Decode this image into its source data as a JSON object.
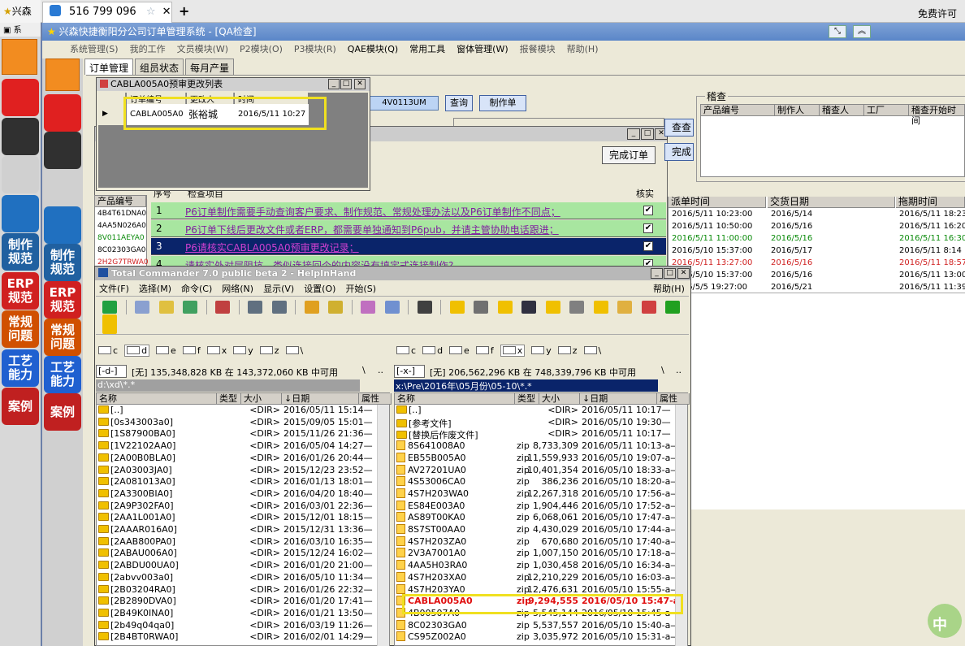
{
  "taskbar": {
    "app_name": "兴森",
    "right_text": "免费许可证"
  },
  "browser": {
    "tab_label": "516 799 096"
  },
  "main_window": {
    "title": "兴森快捷衡阳分公司订单管理系统 - [QA检查]",
    "menu": [
      "系统管理(S)",
      "我的工作",
      "文员模块(W)",
      "P2模块(O)",
      "P3模块(R)",
      "QAE模块(Q)",
      "常用工具",
      "窗体管理(W)",
      "报餐模块",
      "帮助(H)"
    ],
    "tabs": [
      "订单管理",
      "组员状态",
      "每月产量"
    ]
  },
  "left_tools": [
    {
      "label": "",
      "color": "#e02020"
    },
    {
      "label": "",
      "color": "#303030"
    },
    {
      "label": "",
      "color": "#d0d0d0"
    },
    {
      "label": "",
      "color": "#2070c0"
    },
    {
      "label": "制作\n规范",
      "color": "#2060a0"
    },
    {
      "label": "ERP\n规范",
      "color": "#d02020"
    },
    {
      "label": "常规\n问题",
      "color": "#d05000"
    },
    {
      "label": "工艺\n能力",
      "color": "#2060d0"
    },
    {
      "label": "案例",
      "color": "#c02020"
    }
  ],
  "cabla_window": {
    "title": "CABLA005A0预审更改列表",
    "headers": [
      "订单编号",
      "更改人",
      "时间"
    ],
    "row": {
      "order": "CABLA005A0",
      "person": "张裕城",
      "time": "2016/5/11 10:27"
    }
  },
  "main_controls": {
    "order_field": "4V0113UM",
    "query_button": "查询",
    "make_button": "制作单",
    "complete_button": "完成订单",
    "query_button2": "查查",
    "complete_button2": "完成"
  },
  "audit": {
    "title": "稽查",
    "headers": [
      "产品编号",
      "制作人",
      "稽查人",
      "工厂",
      "稽查开始时间"
    ]
  },
  "checklist": {
    "headers": [
      "序号",
      "检查项目",
      "核实"
    ],
    "rows": [
      {
        "n": "1",
        "text": "P6订单制作需要手动查询客户要求、制作规范、常规处理办法以及P6订单制作不同点；"
      },
      {
        "n": "2",
        "text": "P6订单下线后更改文件或者ERP，都需要单独通知到P6pub，并请主管协助电话跟进；"
      },
      {
        "n": "3",
        "text": "P6请核实CABLA005A0预审更改记录；"
      },
      {
        "n": "4",
        "text": "请核实外对层阻抗，类似连接回个的内容没有填定式连接制作?"
      }
    ]
  },
  "product_list": {
    "header": "产品编号",
    "items": [
      "4B4T61DNA0",
      "4AA5N026A0",
      "8V011AEYA0",
      "8C02303GA0",
      "2H2G7TRWA0"
    ]
  },
  "right_table": {
    "headers": [
      "派单时间",
      "交货日期",
      "拖期时间"
    ],
    "rows": [
      {
        "a": "2016/5/11 10:23:00",
        "b": "2016/5/14",
        "c": "2016/5/11 18:23",
        "color": "#000"
      },
      {
        "a": "2016/5/11 10:50:00",
        "b": "2016/5/16",
        "c": "2016/5/11 16:20",
        "color": "#000"
      },
      {
        "a": "2016/5/11 11:00:00",
        "b": "2016/5/16",
        "c": "2016/5/11 16:30",
        "color": "#0a8a0a"
      },
      {
        "a": "2016/5/10 15:37:00",
        "b": "2016/5/17",
        "c": "2016/5/11 8:14",
        "color": "#000"
      },
      {
        "a": "2016/5/11 13:27:00",
        "b": "2016/5/16",
        "c": "2016/5/11 18:57",
        "color": "#d02020"
      },
      {
        "a": "2016/5/10 15:37:00",
        "b": "2016/5/16",
        "c": "2016/5/11 13:00",
        "color": "#000"
      },
      {
        "a": "2016/5/5 19:27:00",
        "b": "2016/5/21",
        "c": "2016/5/11 11:39",
        "color": "#000"
      }
    ]
  },
  "tc": {
    "title": "Total Commander 7.0 public beta 2 - HelpInHand",
    "menu": [
      "文件(F)",
      "选择(M)",
      "命令(C)",
      "网络(N)",
      "显示(V)",
      "设置(O)",
      "开始(S)"
    ],
    "help": "帮助(H)",
    "drives_left": [
      "c",
      "d",
      "e",
      "f",
      "x",
      "y",
      "z",
      "\\"
    ],
    "drives_right": [
      "c",
      "d",
      "e",
      "f",
      "x",
      "y",
      "z",
      "\\"
    ],
    "left": {
      "drive": "[-d-]",
      "info": "[无] 135,348,828 KB 在 143,372,060 KB 中可用",
      "path": "d:\\xd\\*.*",
      "headers": [
        "名称",
        "类型",
        "大小",
        "↓日期",
        "属性"
      ],
      "files": [
        [
          "[..]",
          "",
          "<DIR>",
          "2016/05/11 15:14—"
        ],
        [
          "[0s343003a0]",
          "",
          "<DIR>",
          "2015/09/05 15:01—"
        ],
        [
          "[1S87900BA0]",
          "",
          "<DIR>",
          "2015/11/26 21:36—"
        ],
        [
          "[1V22102AA0]",
          "",
          "<DIR>",
          "2016/05/04 14:27—"
        ],
        [
          "[2A00B0BLA0]",
          "",
          "<DIR>",
          "2016/01/26 20:44—"
        ],
        [
          "[2A03003JA0]",
          "",
          "<DIR>",
          "2015/12/23 23:52—"
        ],
        [
          "[2A081013A0]",
          "",
          "<DIR>",
          "2016/01/13 18:01—"
        ],
        [
          "[2A3300BIA0]",
          "",
          "<DIR>",
          "2016/04/20 18:40—"
        ],
        [
          "[2A9P302FA0]",
          "",
          "<DIR>",
          "2016/03/01 22:36—"
        ],
        [
          "[2AA1L001A0]",
          "",
          "<DIR>",
          "2015/12/01 18:15—"
        ],
        [
          "[2AAAR016A0]",
          "",
          "<DIR>",
          "2015/12/31 13:36—"
        ],
        [
          "[2AAB800PA0]",
          "",
          "<DIR>",
          "2016/03/10 16:35—"
        ],
        [
          "[2ABAU006A0]",
          "",
          "<DIR>",
          "2015/12/24 16:02—"
        ],
        [
          "[2ABDU00UA0]",
          "",
          "<DIR>",
          "2016/01/20 21:00—"
        ],
        [
          "[2abvv003a0]",
          "",
          "<DIR>",
          "2016/05/10 11:34—"
        ],
        [
          "[2B03204RA0]",
          "",
          "<DIR>",
          "2016/01/26 22:32—"
        ],
        [
          "[2B2890DVA0]",
          "",
          "<DIR>",
          "2016/01/20 17:41—"
        ],
        [
          "[2B49K0INA0]",
          "",
          "<DIR>",
          "2016/01/21 13:50—"
        ],
        [
          "[2b49q04qa0]",
          "",
          "<DIR>",
          "2016/03/19 11:26—"
        ],
        [
          "[2B4BT0RWA0]",
          "",
          "<DIR>",
          "2016/02/01 14:29—"
        ]
      ]
    },
    "right": {
      "drive": "[-x-]",
      "info": "[无] 206,562,296 KB 在 748,339,796 KB 中可用",
      "path": "x:\\Pre\\2016年\\05月份\\05-10\\*.*",
      "headers": [
        "名称",
        "类型",
        "大小",
        "↓日期",
        "属性"
      ],
      "files": [
        [
          "[..]",
          "",
          "<DIR>",
          "2016/05/11 10:17—"
        ],
        [
          "[参考文件]",
          "",
          "<DIR>",
          "2016/05/10 19:30—"
        ],
        [
          "[替换后作废文件]",
          "",
          "<DIR>",
          "2016/05/11 10:17—"
        ],
        [
          "8S641008A0",
          "zip",
          "8,733,309",
          "2016/05/11 10:13-a—"
        ],
        [
          "EB55B005A0",
          "zip",
          "11,559,933",
          "2016/05/10 19:07-a—"
        ],
        [
          "AV27201UA0",
          "zip",
          "10,401,354",
          "2016/05/10 18:33-a—"
        ],
        [
          "4S53006CA0",
          "zip",
          "386,236",
          "2016/05/10 18:20-a—"
        ],
        [
          "4S7H203WA0",
          "zip",
          "12,267,318",
          "2016/05/10 17:56-a—"
        ],
        [
          "ES84E003A0",
          "zip",
          "1,904,446",
          "2016/05/10 17:52-a—"
        ],
        [
          "AS89T00KA0",
          "zip",
          "6,068,061",
          "2016/05/10 17:47-a—"
        ],
        [
          "8S7ST00AA0",
          "zip",
          "4,430,029",
          "2016/05/10 17:44-a—"
        ],
        [
          "4S7H203ZA0",
          "zip",
          "670,680",
          "2016/05/10 17:40-a—"
        ],
        [
          "2V3A7001A0",
          "zip",
          "1,007,150",
          "2016/05/10 17:18-a—"
        ],
        [
          "4AA5H03RA0",
          "zip",
          "1,030,458",
          "2016/05/10 16:34-a—"
        ],
        [
          "4S7H203XA0",
          "zip",
          "12,210,229",
          "2016/05/10 16:03-a—"
        ],
        [
          "4S7H203YA0",
          "zip",
          "12,476,631",
          "2016/05/10 15:55-a—"
        ],
        [
          "CABLA005A0",
          "zip",
          "9,294,555",
          "2016/05/10 15:47-a—"
        ],
        [
          "4B00507A0",
          "zip",
          "5,545,144",
          "2016/05/10 15:45-a—"
        ],
        [
          "8C02303GA0",
          "zip",
          "5,537,557",
          "2016/05/10 15:40-a—"
        ],
        [
          "CS95Z002A0",
          "zip",
          "3,035,972",
          "2016/05/10 15:31-a—"
        ]
      ]
    }
  },
  "ime": {
    "label": "中"
  }
}
